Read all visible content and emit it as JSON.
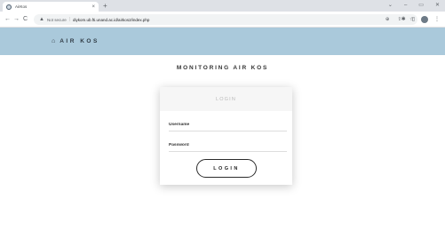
{
  "browser": {
    "tab_title": "AirKos",
    "tab_close": "×",
    "new_tab": "+",
    "window_controls": [
      "⌄",
      "–",
      "▭",
      "✕"
    ],
    "nav": {
      "back": "←",
      "forward": "→",
      "reload": "C"
    },
    "not_secure_label": "Not secure",
    "url": "diykom.ub.fti.unand.ac.id/airkos2/index.php",
    "omnibox_icons": [
      "zoom-icon",
      "share-icon",
      "star-icon"
    ],
    "extension_icons": [
      "extension-icon",
      "sidepanel-icon",
      "profile-avatar",
      "menu-icon"
    ]
  },
  "appbar": {
    "home_icon": "home-icon",
    "brand": "AIR KOS"
  },
  "page": {
    "heading": "MONITORING AIR KOS"
  },
  "login_card": {
    "header": "LOGIN",
    "username_placeholder": "Username",
    "password_placeholder": "Password",
    "button_label": "LOGIN"
  },
  "colors": {
    "appbar_bg": "#aac9db",
    "card_header_bg": "#f6f6f6",
    "tabstrip_bg": "#dee1e6"
  }
}
